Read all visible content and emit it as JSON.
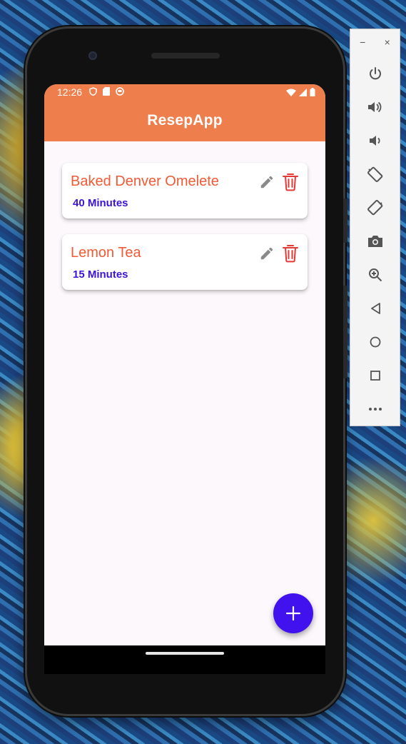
{
  "statusbar": {
    "time": "12:26"
  },
  "appbar": {
    "title": "ResepApp"
  },
  "recipes": [
    {
      "name": "Baked Denver Omelete",
      "duration": "40 Minutes"
    },
    {
      "name": "Lemon Tea",
      "duration": "15 Minutes"
    }
  ],
  "fab": {
    "icon": "plus-icon"
  },
  "emulator_toolbar": {
    "window_controls": {
      "minimize": "−",
      "close": "×"
    },
    "buttons": [
      "power-icon",
      "volume-up-icon",
      "volume-down-icon",
      "rotate-left-icon",
      "rotate-right-icon",
      "camera-icon",
      "zoom-icon",
      "back-icon",
      "home-icon",
      "overview-icon",
      "more-icon"
    ]
  },
  "colors": {
    "appbar": "#ee7e4b",
    "title": "#f15a35",
    "duration": "#3b13d6",
    "fab": "#4112ee",
    "delete": "#e53935"
  }
}
